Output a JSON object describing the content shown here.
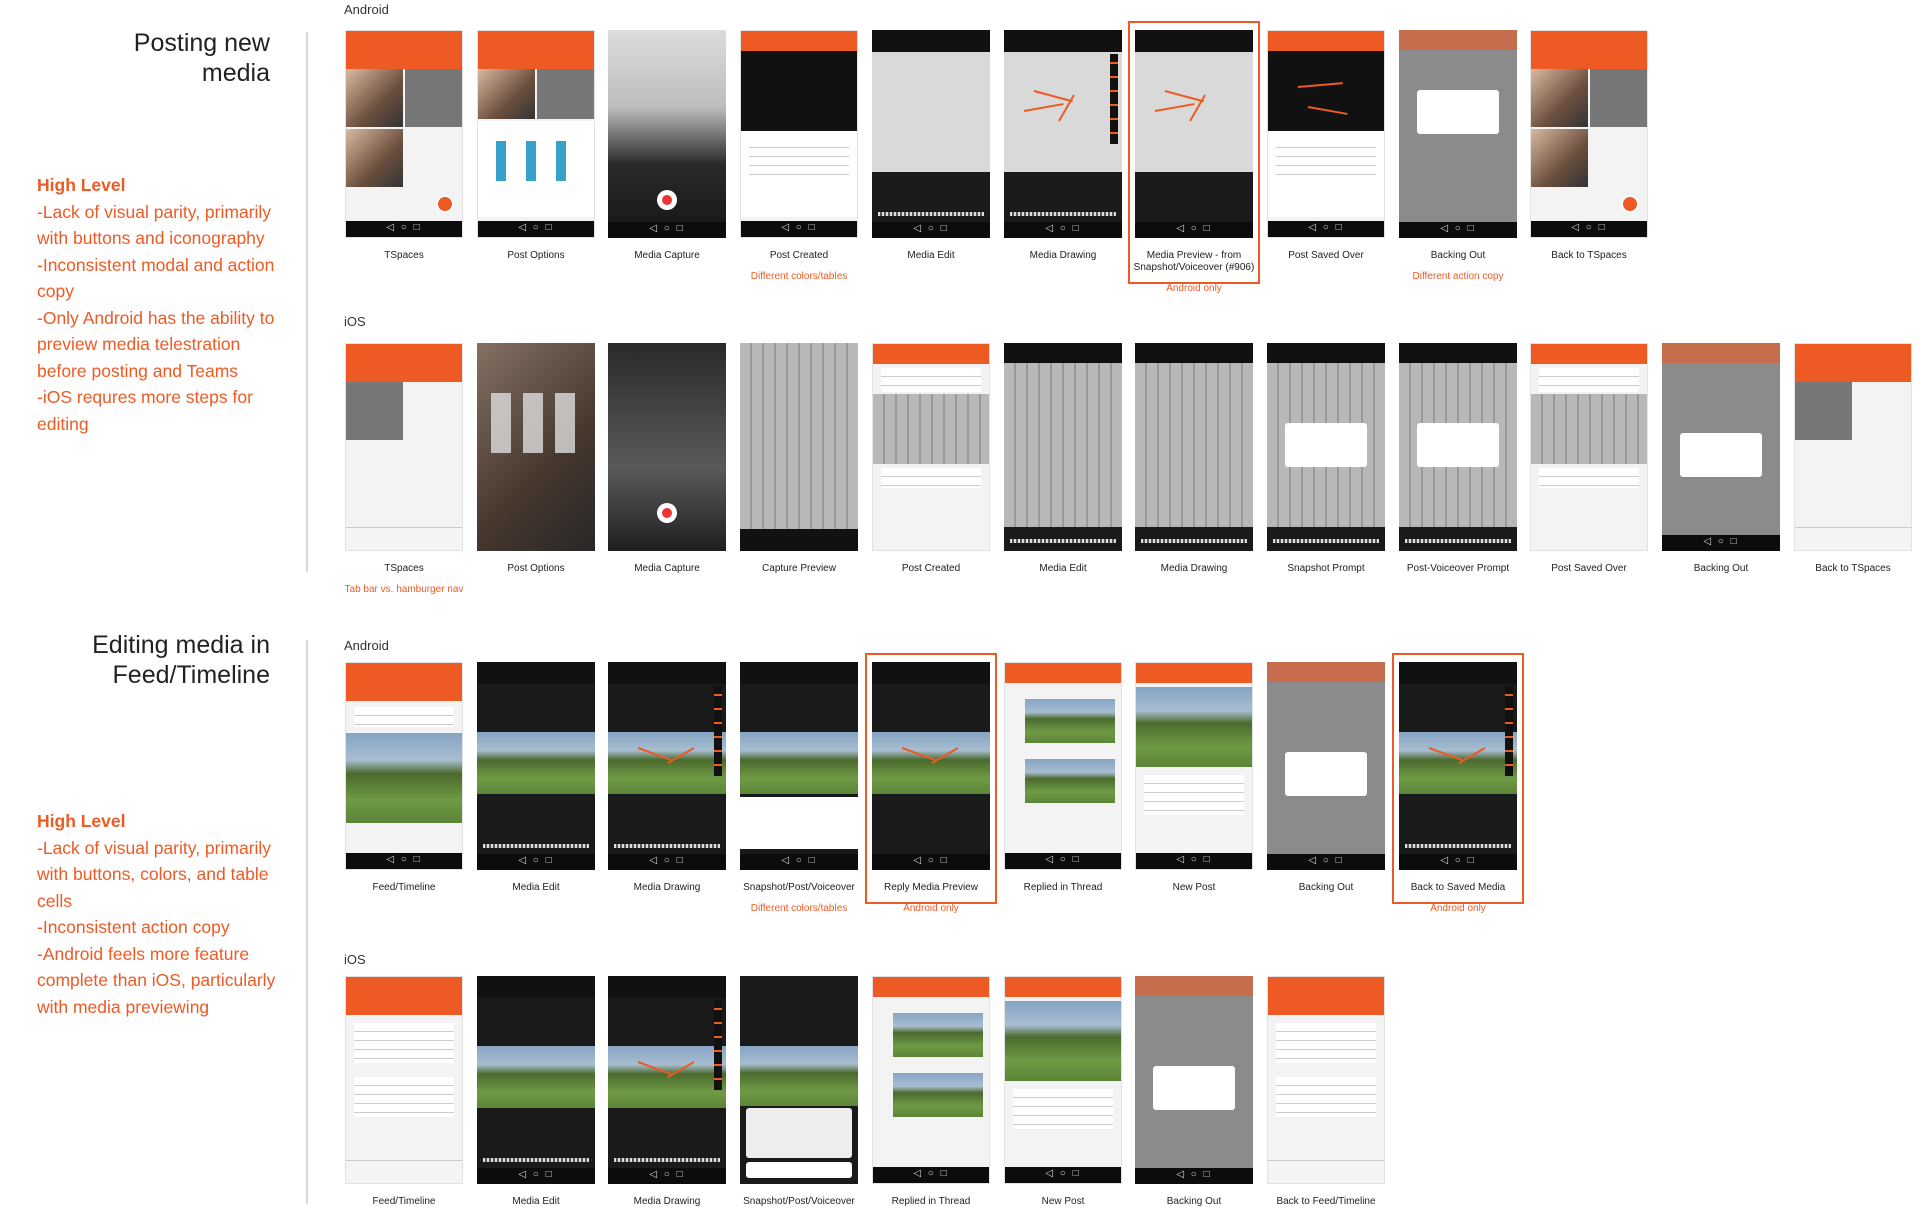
{
  "sections": [
    {
      "title": "Posting new\nmedia",
      "high_level": {
        "heading": "High Level",
        "points": [
          "-Lack of visual parity, primarily with buttons and iconography",
          "-Inconsistent modal and action copy",
          "-Only Android has the ability to preview media telestration before posting and Teams",
          "-iOS requres more steps for editing"
        ]
      },
      "rows": [
        {
          "platform": "Android",
          "screens": [
            {
              "caption": "TSpaces",
              "note": ""
            },
            {
              "caption": "Post Options",
              "note": ""
            },
            {
              "caption": "Media Capture",
              "note": ""
            },
            {
              "caption": "Post Created",
              "note": "Different colors/tables"
            },
            {
              "caption": "Media Edit",
              "note": ""
            },
            {
              "caption": "Media Drawing",
              "note": ""
            },
            {
              "caption": "Media Preview - from Snapshot/Voiceover (#906)",
              "note": "Android only"
            },
            {
              "caption": "Post Saved Over",
              "note": ""
            },
            {
              "caption": "Backing Out",
              "note": "Different action copy"
            },
            {
              "caption": "Back to TSpaces",
              "note": ""
            }
          ]
        },
        {
          "platform": "iOS",
          "screens": [
            {
              "caption": "TSpaces",
              "note": "Tab bar vs. hamburger nav"
            },
            {
              "caption": "Post Options",
              "note": ""
            },
            {
              "caption": "Media Capture",
              "note": ""
            },
            {
              "caption": "Capture Preview",
              "note": ""
            },
            {
              "caption": "Post Created",
              "note": ""
            },
            {
              "caption": "Media Edit",
              "note": ""
            },
            {
              "caption": "Media Drawing",
              "note": ""
            },
            {
              "caption": "Snapshot Prompt",
              "note": ""
            },
            {
              "caption": "Post-Voiceover Prompt",
              "note": ""
            },
            {
              "caption": "Post Saved Over",
              "note": ""
            },
            {
              "caption": "Backing Out",
              "note": ""
            },
            {
              "caption": "Back to TSpaces",
              "note": ""
            }
          ]
        }
      ]
    },
    {
      "title": "Editing media in\nFeed/Timeline",
      "high_level": {
        "heading": "High Level",
        "points": [
          "-Lack of visual parity, primarily with buttons, colors, and table cells",
          "-Inconsistent action copy",
          "-Android feels more feature complete than iOS, particularly with media previewing"
        ]
      },
      "rows": [
        {
          "platform": "Android",
          "screens": [
            {
              "caption": "Feed/Timeline",
              "note": ""
            },
            {
              "caption": "Media Edit",
              "note": ""
            },
            {
              "caption": "Media Drawing",
              "note": ""
            },
            {
              "caption": "Snapshot/Post/Voiceover",
              "note": "Different colors/tables"
            },
            {
              "caption": "Reply Media Preview",
              "note": "Android only"
            },
            {
              "caption": "Replied in Thread",
              "note": ""
            },
            {
              "caption": "New Post",
              "note": ""
            },
            {
              "caption": "Backing Out",
              "note": ""
            },
            {
              "caption": "Back to Saved Media",
              "note": "Android only"
            }
          ]
        },
        {
          "platform": "iOS",
          "screens": [
            {
              "caption": "Feed/Timeline",
              "note": ""
            },
            {
              "caption": "Media Edit",
              "note": ""
            },
            {
              "caption": "Media Drawing",
              "note": ""
            },
            {
              "caption": "Snapshot/Post/Voiceover",
              "note": ""
            },
            {
              "caption": "Replied in Thread",
              "note": ""
            },
            {
              "caption": "New Post",
              "note": ""
            },
            {
              "caption": "Backing Out",
              "note": ""
            },
            {
              "caption": "Back to Feed/Timeline",
              "note": ""
            }
          ]
        }
      ]
    }
  ],
  "colors": {
    "accent": "#ee5a24",
    "text": "#222222",
    "divider": "#d8d8d8"
  }
}
